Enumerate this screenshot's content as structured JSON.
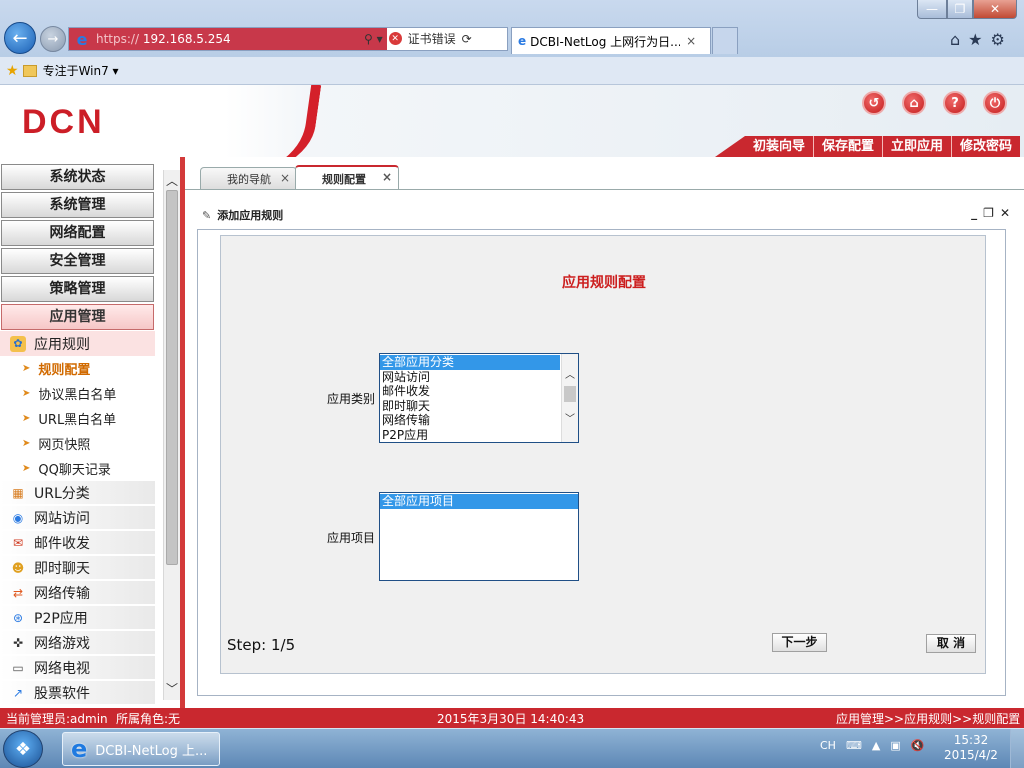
{
  "browser": {
    "url_protocol": "https://",
    "url_host": "192.168.5.254",
    "cert_error": "证书错误",
    "tab_title": "DCBI-NetLog 上网行为日...",
    "tab_close": "×",
    "back_icon": "arrow-left-icon",
    "window_min": "—",
    "window_max": "❐",
    "window_close": "✕",
    "favorites_item": "专注于Win7 ▾"
  },
  "header": {
    "logo": "DCN",
    "menu": [
      "初装向导",
      "保存配置",
      "立即应用",
      "修改密码"
    ]
  },
  "sidebar": {
    "menus": [
      "系统状态",
      "系统管理",
      "网络配置",
      "安全管理",
      "策略管理",
      "应用管理"
    ],
    "open_group": "应用规则",
    "sub_items": [
      "规则配置",
      "协议黑白名单",
      "URL黑白名单",
      "网页快照",
      "QQ聊天记录"
    ],
    "current_sub": "规则配置",
    "app_groups": [
      "URL分类",
      "网站访问",
      "邮件收发",
      "即时聊天",
      "网络传输",
      "P2P应用",
      "网络游戏",
      "网络电视",
      "股票软件"
    ]
  },
  "tabs": [
    {
      "label": "我的导航",
      "active": false
    },
    {
      "label": "规则配置",
      "active": true
    }
  ],
  "panel": {
    "title": "添加应用规则",
    "form_title": "应用规则配置",
    "category_label": "应用类别",
    "category_options": [
      "全部应用分类",
      "网站访问",
      "邮件收发",
      "即时聊天",
      "网络传输",
      "P2P应用"
    ],
    "item_label": "应用项目",
    "item_options": [
      "全部应用项目"
    ],
    "step": "Step: 1/5",
    "next_button": "下一步",
    "cancel_button": "取 消"
  },
  "statusbar": {
    "admin": "当前管理员:admin",
    "role": "所属角色:无",
    "datetime": "2015年3月30日 14:40:43",
    "breadcrumb": "应用管理>>应用规则>>规则配置"
  },
  "taskbar": {
    "ie_label": "DCBI-NetLog 上...",
    "lang": "CH",
    "time": "15:32",
    "date": "2015/4/2"
  },
  "colors": {
    "brand_red": "#c9282f",
    "selection_blue": "#3397e8"
  }
}
